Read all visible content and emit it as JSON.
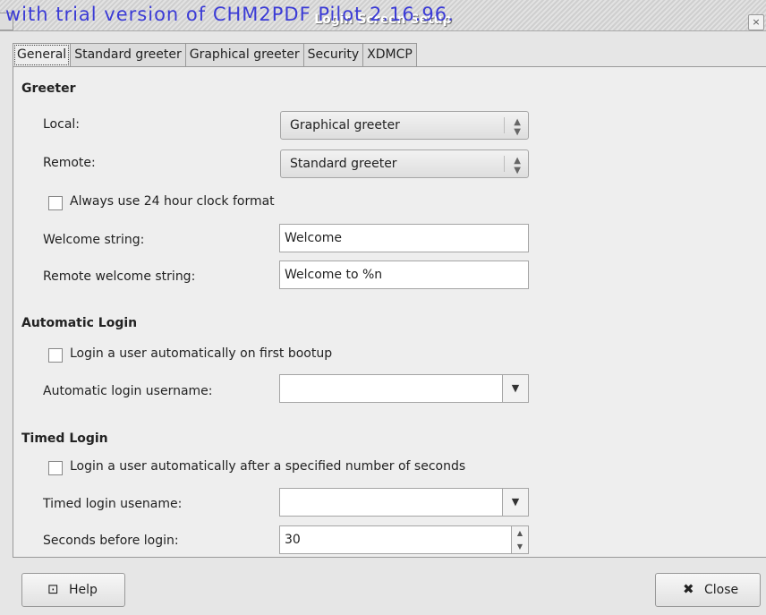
{
  "window": {
    "title": "Login Screen Setup",
    "close_glyph": "×",
    "watermark": "with trial version of CHM2PDF Pilot 2.16.96."
  },
  "tabs": [
    {
      "label": "General"
    },
    {
      "label": "Standard greeter"
    },
    {
      "label": "Graphical greeter"
    },
    {
      "label": "Security"
    },
    {
      "label": "XDMCP"
    }
  ],
  "greeter": {
    "heading": "Greeter",
    "local_label": "Local:",
    "local_value": "Graphical greeter",
    "remote_label": "Remote:",
    "remote_value": "Standard greeter",
    "clock_label": "Always use 24 hour clock format",
    "welcome_label": "Welcome string:",
    "welcome_value": "Welcome",
    "remote_welcome_label": "Remote welcome string:",
    "remote_welcome_value": "Welcome to %n"
  },
  "auto_login": {
    "heading": "Automatic Login",
    "check_label": "Login a user automatically on first bootup",
    "username_label": "Automatic login username:",
    "username_value": ""
  },
  "timed_login": {
    "heading": "Timed Login",
    "check_label": "Login a user automatically after a specified number of seconds",
    "username_label": "Timed login usename:",
    "username_value": "",
    "seconds_label": "Seconds before login:",
    "seconds_value": "30"
  },
  "footer": {
    "help_label": "Help",
    "close_label": "Close"
  },
  "icons": {
    "help": "help-icon",
    "close": "close-x-icon"
  }
}
